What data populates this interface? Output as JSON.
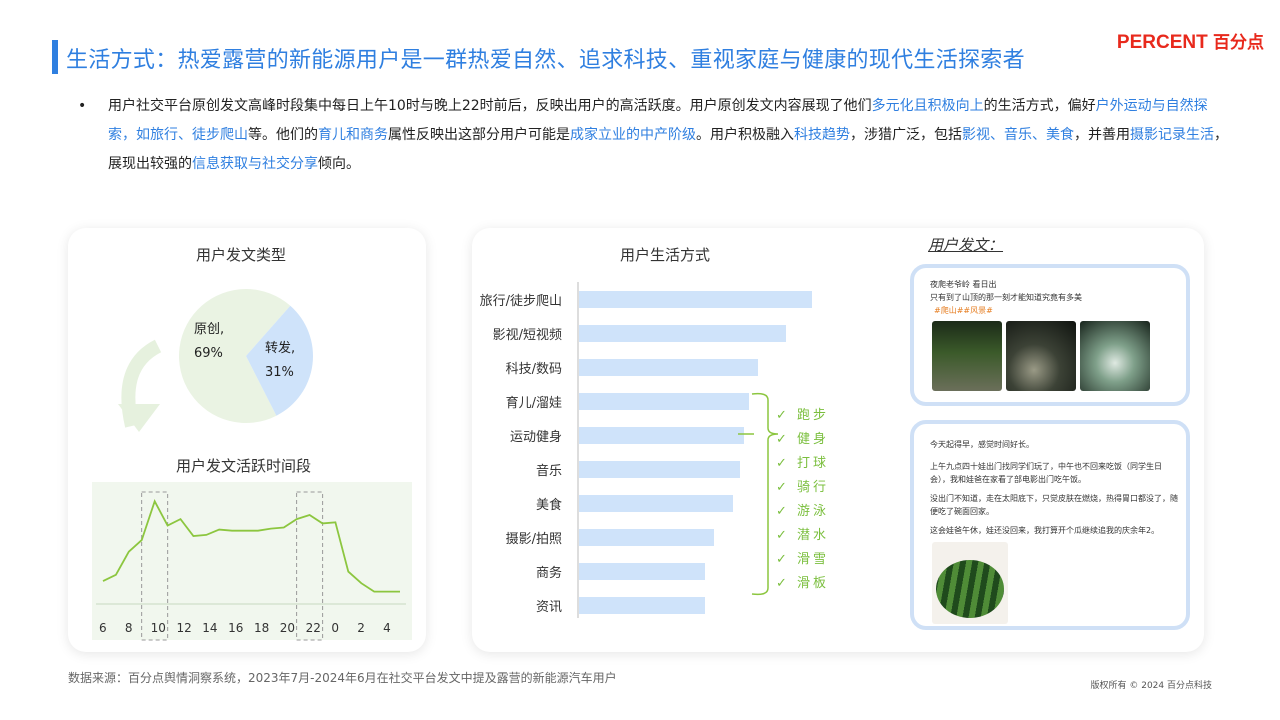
{
  "header": {
    "title": "生活方式：热爱露营的新能源用户是一群热爱自然、追求科技、重视家庭与健康的现代生活探索者",
    "brand_en": "PERCENT",
    "brand_cn": "百分点"
  },
  "summary": {
    "bullet": "•",
    "segments": [
      {
        "t": "用户社交平台原创发文高峰时段集中每日上午10时与晚上22时前后，反映出用户的高活跃度。用户原创发文内容展现了他们",
        "h": false
      },
      {
        "t": "多元化且积极向上",
        "h": true
      },
      {
        "t": "的生活方式，偏好",
        "h": false
      },
      {
        "t": "户外运动与自然探索，如旅行、徒步爬山",
        "h": true
      },
      {
        "t": "等。他们的",
        "h": false
      },
      {
        "t": "育儿和商务",
        "h": true
      },
      {
        "t": "属性反映出这部分用户可能是",
        "h": false
      },
      {
        "t": "成家立业的中产阶级",
        "h": true
      },
      {
        "t": "。用户积极融入",
        "h": false
      },
      {
        "t": "科技趋势",
        "h": true
      },
      {
        "t": "，涉猎广泛，包括",
        "h": false
      },
      {
        "t": "影视、音乐、美食",
        "h": true
      },
      {
        "t": "，并善用",
        "h": false
      },
      {
        "t": "摄影记录生活",
        "h": true
      },
      {
        "t": "，展现出较强的",
        "h": false
      },
      {
        "t": "信息获取与社交分享",
        "h": true
      },
      {
        "t": "倾向。",
        "h": false
      }
    ]
  },
  "chart_data": [
    {
      "type": "pie",
      "title": "用户发文类型",
      "slices": [
        {
          "name": "原创,",
          "value": 69,
          "label": "69%",
          "color": "#eaf3e3"
        },
        {
          "name": "转发,",
          "value": 31,
          "label": "31%",
          "color": "#cfe3fa"
        }
      ]
    },
    {
      "type": "line",
      "title": "用户发文活跃时间段",
      "x_tick_labels": [
        "6",
        "8",
        "10",
        "12",
        "14",
        "16",
        "18",
        "20",
        "22",
        "0",
        "2",
        "4"
      ],
      "x": [
        6,
        7,
        8,
        9,
        10,
        11,
        12,
        13,
        14,
        15,
        16,
        17,
        18,
        19,
        20,
        21,
        22,
        23,
        24,
        25,
        26,
        27,
        28,
        29
      ],
      "values": [
        18,
        24,
        46,
        57,
        94,
        71,
        77,
        61,
        62,
        67,
        66,
        66,
        66,
        68,
        69,
        77,
        81,
        73,
        74,
        27,
        16,
        8,
        8,
        8
      ],
      "ylim": [
        0,
        100
      ],
      "highlight_hours": [
        10,
        22
      ],
      "color": "#8cc63f"
    },
    {
      "type": "bar",
      "orientation": "horizontal",
      "title": "用户生活方式",
      "categories": [
        "旅行/徒步爬山",
        "影视/短视频",
        "科技/数码",
        "育儿/溜娃",
        "运动健身",
        "音乐",
        "美食",
        "摄影/拍照",
        "商务",
        "资讯"
      ],
      "values": [
        100,
        89,
        77,
        73,
        71,
        69,
        66,
        58,
        54,
        54
      ],
      "xlim": [
        0,
        100
      ],
      "color": "#cfe3fa"
    }
  ],
  "sports": {
    "check": "✓",
    "items": [
      "跑步",
      "健身",
      "打球",
      "骑行",
      "游泳",
      "潜水",
      "滑雪",
      "滑板"
    ]
  },
  "posts": {
    "title": "用户发文：",
    "post1": {
      "line1": "夜爬老爷岭 看日出",
      "line2": "只有到了山顶的那一刻才能知道究竟有多美",
      "tags": "#爬山##风景#"
    },
    "post2": {
      "p1": "今天起得早，感觉时间好长。",
      "p2": "上午九点四十娃出门找同学们玩了，中午也不回来吃饭（同学生日会），我和娃爸在家看了部电影出门吃午饭。",
      "p3": "没出门不知道，走在太阳底下，只觉皮肤在燃烧，热得胃口都没了，随便吃了碗面回家。",
      "p4": "这会娃爸午休，娃还没回来，我打算开个瓜继续追我的庆余年2。"
    }
  },
  "footer": {
    "source": "数据来源：百分点舆情洞察系统，2023年7月-2024年6月在社交平台发文中提及露营的新能源汽车用户",
    "copyright": "版权所有 © 2024 百分点科技"
  }
}
